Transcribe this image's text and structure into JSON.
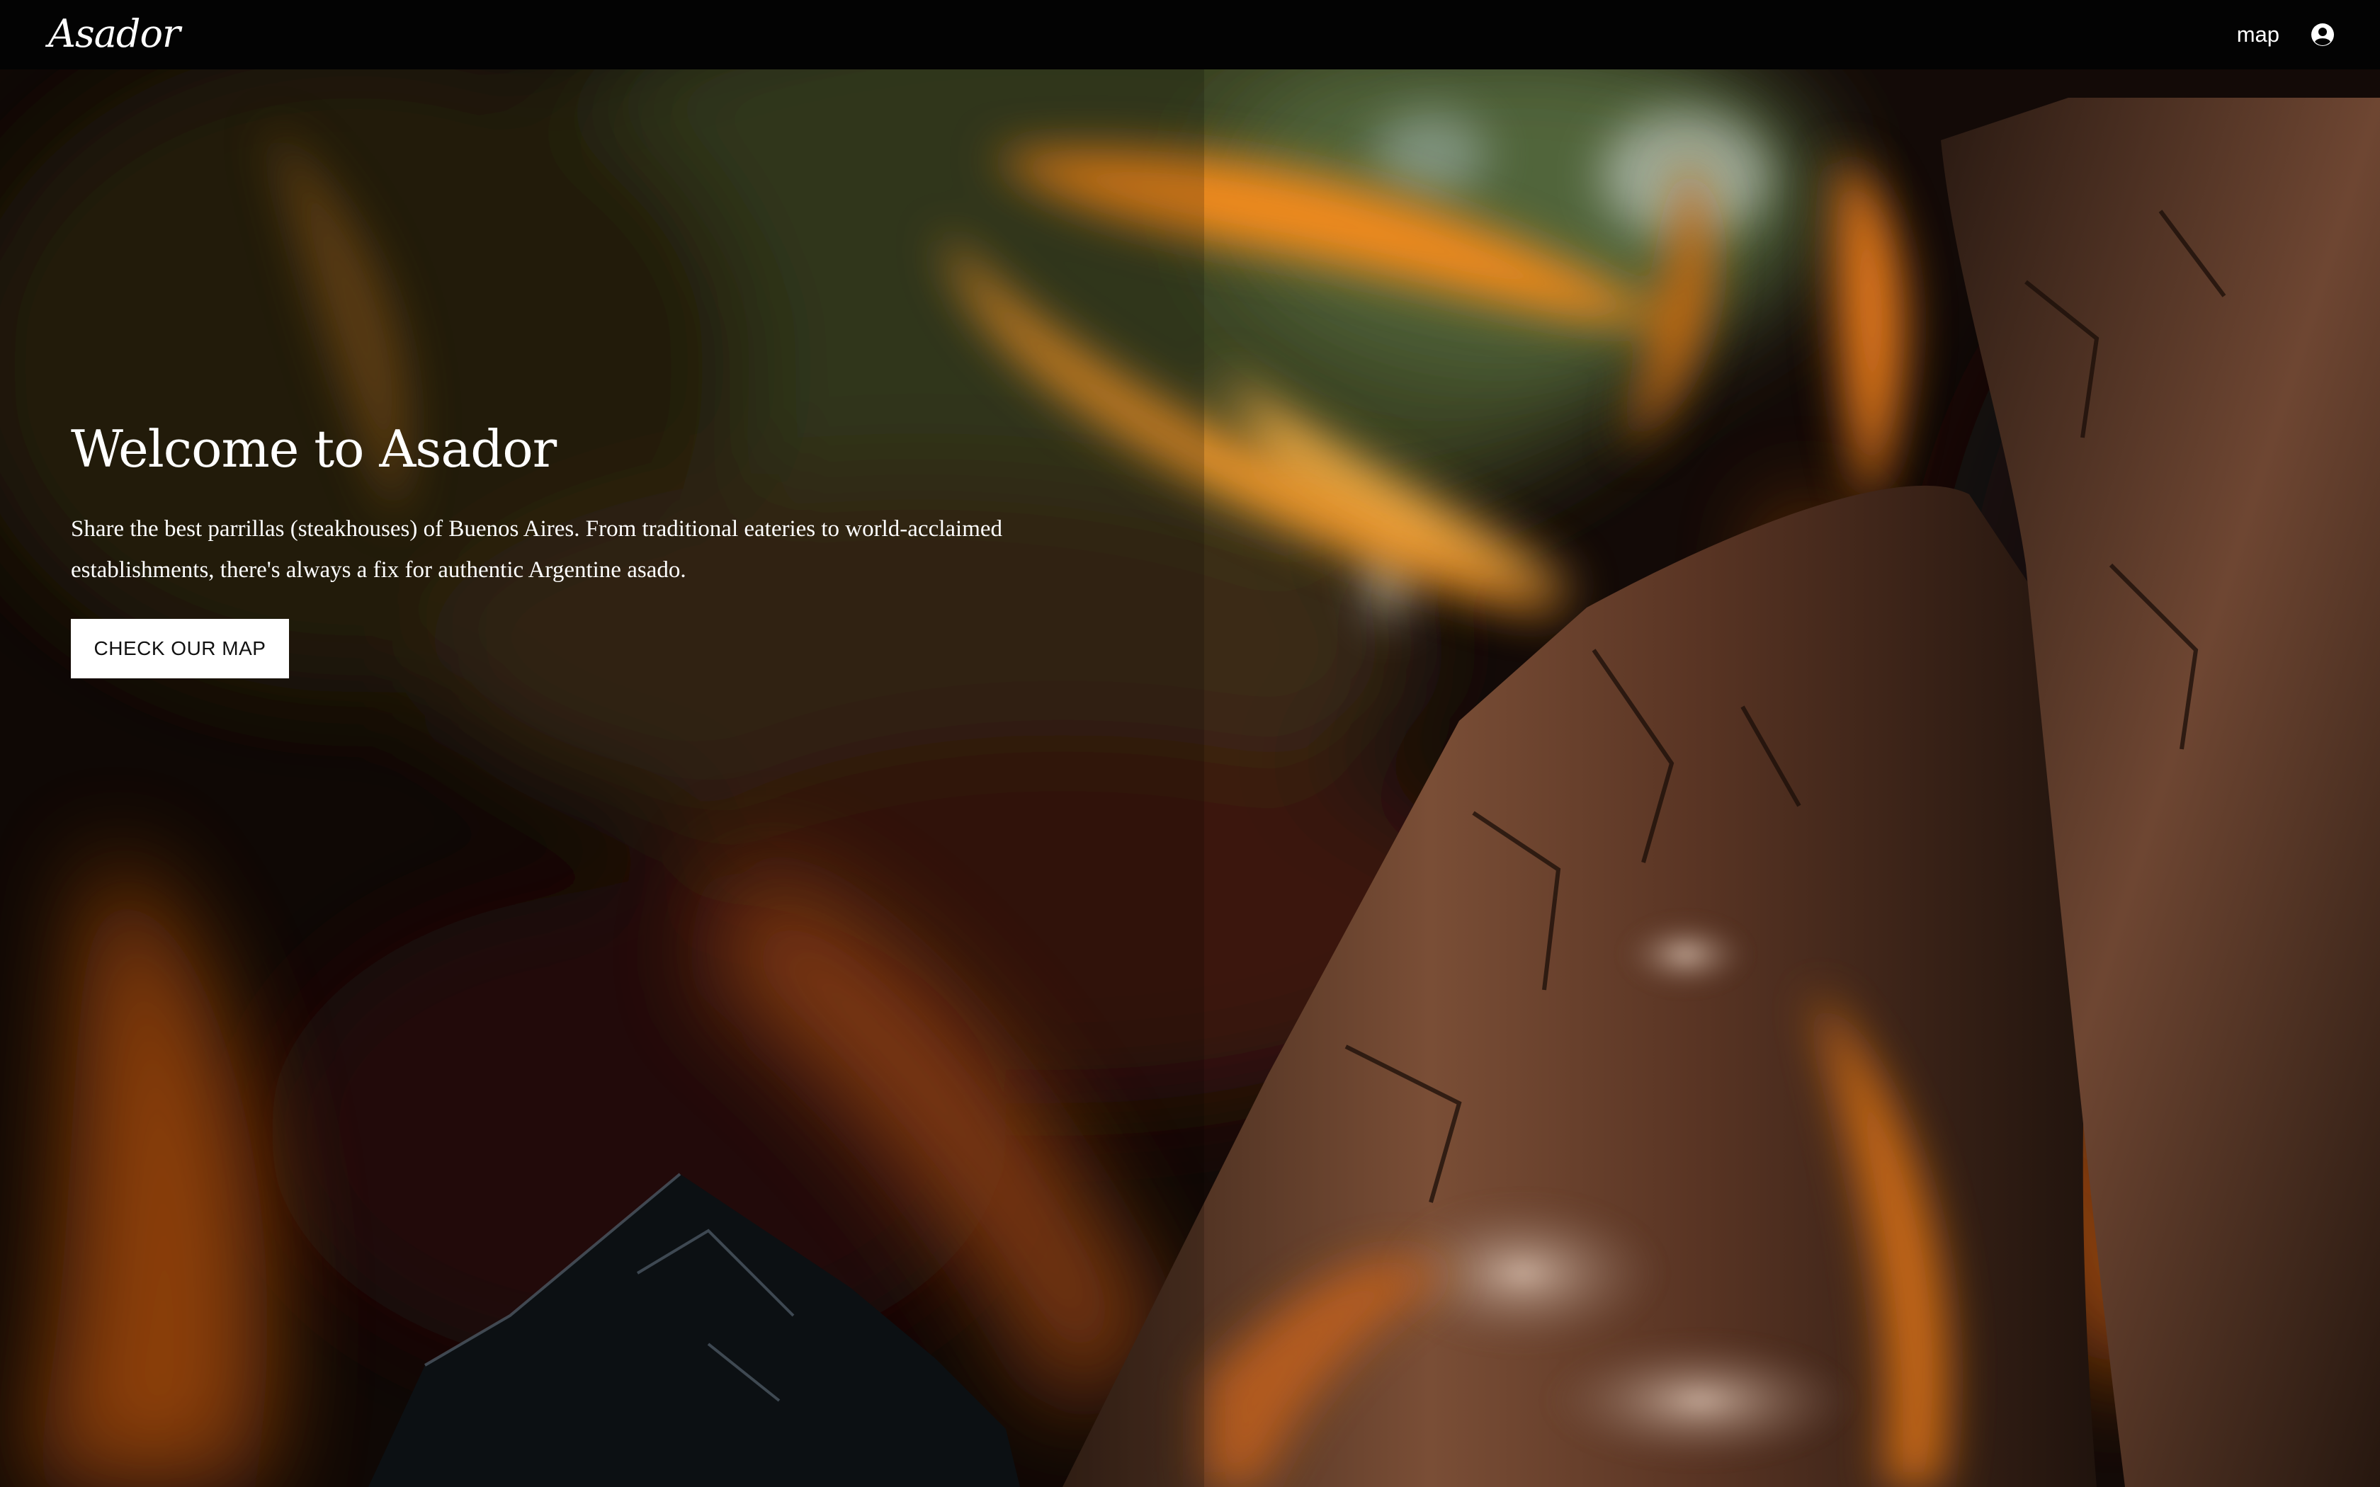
{
  "nav": {
    "brand": "Asador",
    "links": [
      {
        "label": "map"
      }
    ],
    "account_icon": "user-circle-icon"
  },
  "hero": {
    "title": "Welcome to Asador",
    "description": "Share the best parrillas (steakhouses) of Buenos Aires. From traditional eateries to world-acclaimed establishments, there's always a fix for authentic Argentine asado.",
    "cta_label": "CHECK OUR MAP",
    "background": "campfire-photo"
  },
  "colors": {
    "nav_background": "#030303",
    "text": "#ffffff",
    "button_background": "#ffffff",
    "button_text": "#111111",
    "flame": "#f08a1c"
  }
}
